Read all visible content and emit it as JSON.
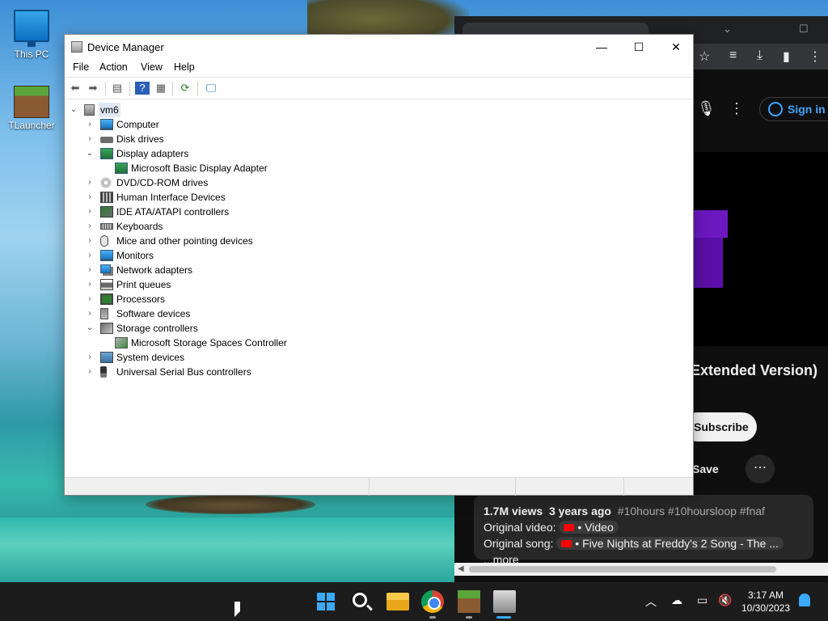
{
  "desktop": {
    "icons": [
      {
        "label": "This PC"
      },
      {
        "label": "TLauncher"
      }
    ]
  },
  "browser": {
    "sign_in": "Sign in",
    "video_title_fragment": "Extended Version)",
    "subscribe": "Subscribe",
    "save": "Save",
    "more_icon": "⋯",
    "description": {
      "views": "1.7M views",
      "age": "3 years ago",
      "tags": "#10hours #10hoursloop #fnaf",
      "original_video_label": "Original video:",
      "original_video_chip": "• Video",
      "original_song_label": "Original song:",
      "original_song_chip": "• Five Nights at Freddy's 2 Song - The ...",
      "more": "...more"
    }
  },
  "device_manager": {
    "title": "Device Manager",
    "window_buttons": {
      "minimize": "—",
      "maximize": "☐",
      "close": "✕"
    },
    "menu": [
      "File",
      "Action",
      "View",
      "Help"
    ],
    "root": "vm6",
    "categories": [
      {
        "label": "Computer",
        "expanded": false,
        "icon": "computer-icon"
      },
      {
        "label": "Disk drives",
        "expanded": false,
        "icon": "disk-drive-icon"
      },
      {
        "label": "Display adapters",
        "expanded": true,
        "icon": "display-adapter-icon"
      },
      {
        "label": "Microsoft Basic Display Adapter",
        "child": true,
        "icon": "display-adapter-icon"
      },
      {
        "label": "DVD/CD-ROM drives",
        "expanded": false,
        "icon": "dvd-icon"
      },
      {
        "label": "Human Interface Devices",
        "expanded": false,
        "icon": "hid-icon"
      },
      {
        "label": "IDE ATA/ATAPI controllers",
        "expanded": false,
        "icon": "ide-controller-icon"
      },
      {
        "label": "Keyboards",
        "expanded": false,
        "icon": "keyboard-icon"
      },
      {
        "label": "Mice and other pointing devices",
        "expanded": false,
        "icon": "mouse-icon"
      },
      {
        "label": "Monitors",
        "expanded": false,
        "icon": "monitor-icon"
      },
      {
        "label": "Network adapters",
        "expanded": false,
        "icon": "network-adapter-icon"
      },
      {
        "label": "Print queues",
        "expanded": false,
        "icon": "printer-icon"
      },
      {
        "label": "Processors",
        "expanded": false,
        "icon": "processor-icon"
      },
      {
        "label": "Software devices",
        "expanded": false,
        "icon": "software-device-icon"
      },
      {
        "label": "Storage controllers",
        "expanded": true,
        "icon": "storage-controller-icon"
      },
      {
        "label": "Microsoft Storage Spaces Controller",
        "child": true,
        "icon": "storage-controller-icon"
      },
      {
        "label": "System devices",
        "expanded": false,
        "icon": "system-device-icon"
      },
      {
        "label": "Universal Serial Bus controllers",
        "expanded": false,
        "icon": "usb-icon"
      }
    ]
  },
  "taskbar": {
    "time": "3:17 AM",
    "date": "10/30/2023"
  },
  "colors": {
    "accent": "#3aa9ff",
    "youtube_red": "#ff0000",
    "link_blue": "#3ea6ff"
  }
}
